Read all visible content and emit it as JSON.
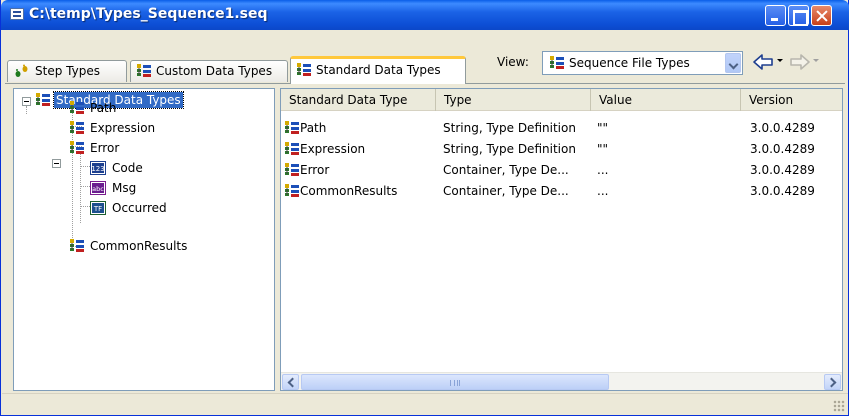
{
  "window": {
    "title": "C:\\temp\\Types_Sequence1.seq"
  },
  "tabs": [
    {
      "label": "Step Types",
      "icon": "step-types-icon",
      "selected": false
    },
    {
      "label": "Custom Data Types",
      "icon": "type-tree-icon",
      "selected": false
    },
    {
      "label": "Standard Data Types",
      "icon": "type-tree-icon",
      "selected": true
    }
  ],
  "view": {
    "label": "View:",
    "selected": "Sequence File Types"
  },
  "tree": {
    "root": "Standard Data Types",
    "path": "Path",
    "expression": "Expression",
    "error": "Error",
    "code": "Code",
    "msg": "Msg",
    "occurred": "Occurred",
    "commonresults": "CommonResults"
  },
  "list": {
    "columns": [
      "Standard Data Type",
      "Type",
      "Value",
      "Version"
    ],
    "rows": [
      {
        "name": "Path",
        "type": "String, Type Definition",
        "value": "\"\"",
        "version": "3.0.0.4289"
      },
      {
        "name": "Expression",
        "type": "String, Type Definition",
        "value": "\"\"",
        "version": "3.0.0.4289"
      },
      {
        "name": "Error",
        "type": "Container, Type De...",
        "value": "...",
        "version": "3.0.0.4289"
      },
      {
        "name": "CommonResults",
        "type": "Container, Type De...",
        "value": "...",
        "version": "3.0.0.4289"
      }
    ]
  },
  "colors": {
    "titlebar": "#0b47c9",
    "selection": "#316ac5",
    "tab_highlight": "#ffc83c"
  }
}
